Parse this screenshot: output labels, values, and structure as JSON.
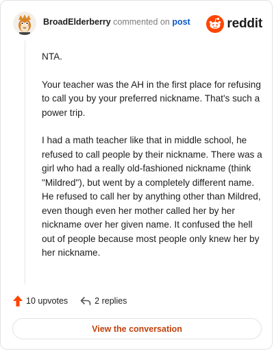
{
  "header": {
    "username": "BroadElderberry",
    "commented_text": "commented on",
    "post_link": "post",
    "brand": "reddit"
  },
  "comment": {
    "paragraphs": [
      "NTA.",
      "Your teacher was the AH in the first place for refusing to call you by your preferred nickname. That's such a power trip.",
      "I had a math teacher like that in middle school, he refused to call people by their nickname. There was a girl who had a really old-fashioned nickname (think \"Mildred\"), but went by a completely different name. He refused to call her by anything other than Mildred, even though even her mother called her by her nickname over her given name. It confused the hell out of people because most people only knew her by her nickname."
    ]
  },
  "actions": {
    "upvotes": "10 upvotes",
    "replies": "2 replies"
  },
  "cta": {
    "label": "View the conversation"
  },
  "colors": {
    "upvote": "#ff4500",
    "brand": "#ff4500",
    "link": "#0a58ca",
    "cta": "#c2410c"
  },
  "icons": {
    "avatar": "avatar-icon",
    "brand": "reddit-logo-icon",
    "upvote": "upvote-arrow-icon",
    "reply": "reply-arrow-icon"
  }
}
